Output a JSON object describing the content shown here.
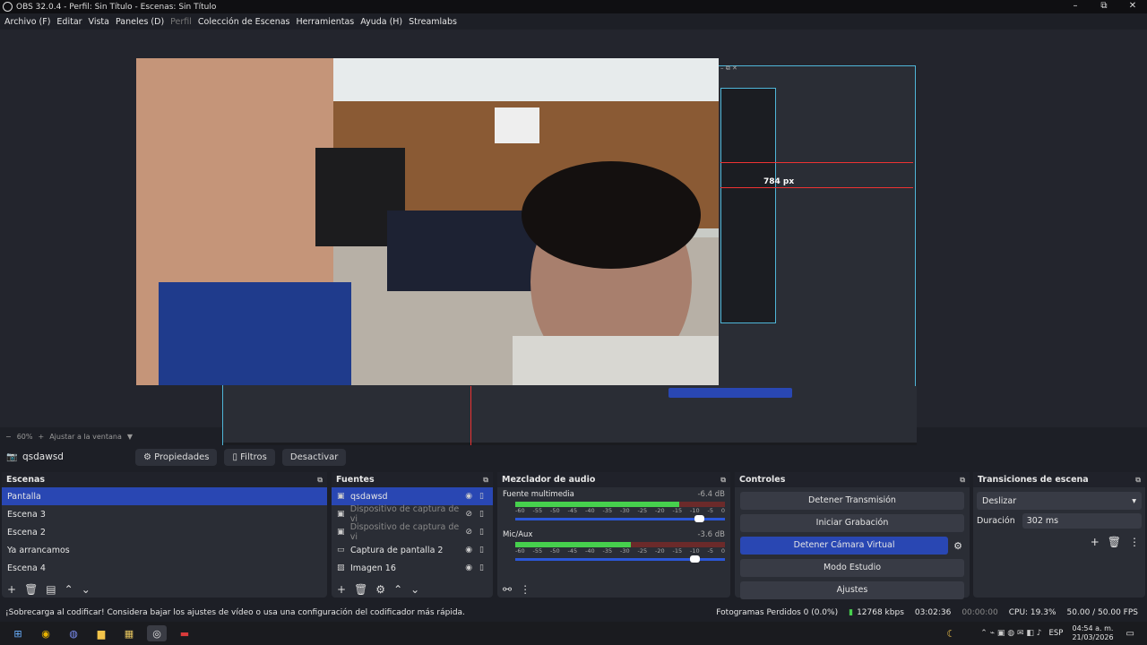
{
  "window": {
    "title": "OBS 32.0.4 - Perfil: Sin Título - Escenas: Sin Título",
    "minimize": "–",
    "maximize": "⧉",
    "close": "✕"
  },
  "menu": [
    "Archivo (F)",
    "Editar",
    "Vista",
    "Paneles (D)",
    "Perfil",
    "Colección de Escenas",
    "Herramientas",
    "Ayuda (H)",
    "Streamlabs"
  ],
  "preview": {
    "measure_label": "784 px",
    "zoom": "60%",
    "fit": "Ajustar a la ventana"
  },
  "source_bar": {
    "name": "qsdawsd",
    "props": "Propiedades",
    "filters": "Filtros",
    "deactivate": "Desactivar"
  },
  "scenes": {
    "title": "Escenas",
    "items": [
      "Pantalla",
      "Escena 3",
      "Escena 2",
      "Ya arrancamos",
      "Escena 4"
    ],
    "selected": 0
  },
  "sources": {
    "title": "Fuentes",
    "items": [
      {
        "name": "qsdawsd",
        "icon": "camera-icon"
      },
      {
        "name": "Dispositivo de captura de vi",
        "icon": "camera-icon"
      },
      {
        "name": "Dispositivo de captura de vi",
        "icon": "camera-icon"
      },
      {
        "name": "Captura de pantalla 2",
        "icon": "monitor-icon"
      },
      {
        "name": "Imagen 16",
        "icon": "image-icon"
      }
    ]
  },
  "mixer": {
    "title": "Mezclador de audio",
    "channels": [
      {
        "name": "Fuente multimedia",
        "db": "-6.4 dB",
        "level": 0.78,
        "volume": 0.9
      },
      {
        "name": "Mic/Aux",
        "db": "-3.6 dB",
        "level": 0.55,
        "volume": 0.88
      }
    ],
    "scale": [
      "-60",
      "-55",
      "-50",
      "-45",
      "-40",
      "-35",
      "-30",
      "-25",
      "-20",
      "-15",
      "-10",
      "-5",
      "0"
    ]
  },
  "controls": {
    "title": "Controles",
    "stop_stream": "Detener Transmisión",
    "start_rec": "Iniciar Grabación",
    "stop_vcam": "Detener Cámara Virtual",
    "studio": "Modo Estudio",
    "settings": "Ajustes"
  },
  "transitions": {
    "title": "Transiciones de escena",
    "type": "Deslizar",
    "duration_label": "Duración",
    "duration": "302 ms"
  },
  "status": {
    "warning": "¡Sobrecarga al codificar! Considera bajar los ajustes de vídeo o usa una configuración del codificador más rápida.",
    "dropped": "Fotogramas Perdidos 0 (0.0%)",
    "bitrate": "12768 kbps",
    "stream_time": "03:02:36",
    "rec_time": "00:00:00",
    "cpu": "CPU: 19.3%",
    "fps": "50.00 / 50.00 FPS"
  },
  "taskbar": {
    "lang": "ESP",
    "time": "04:54 a. m.",
    "date": "21/03/2026"
  }
}
